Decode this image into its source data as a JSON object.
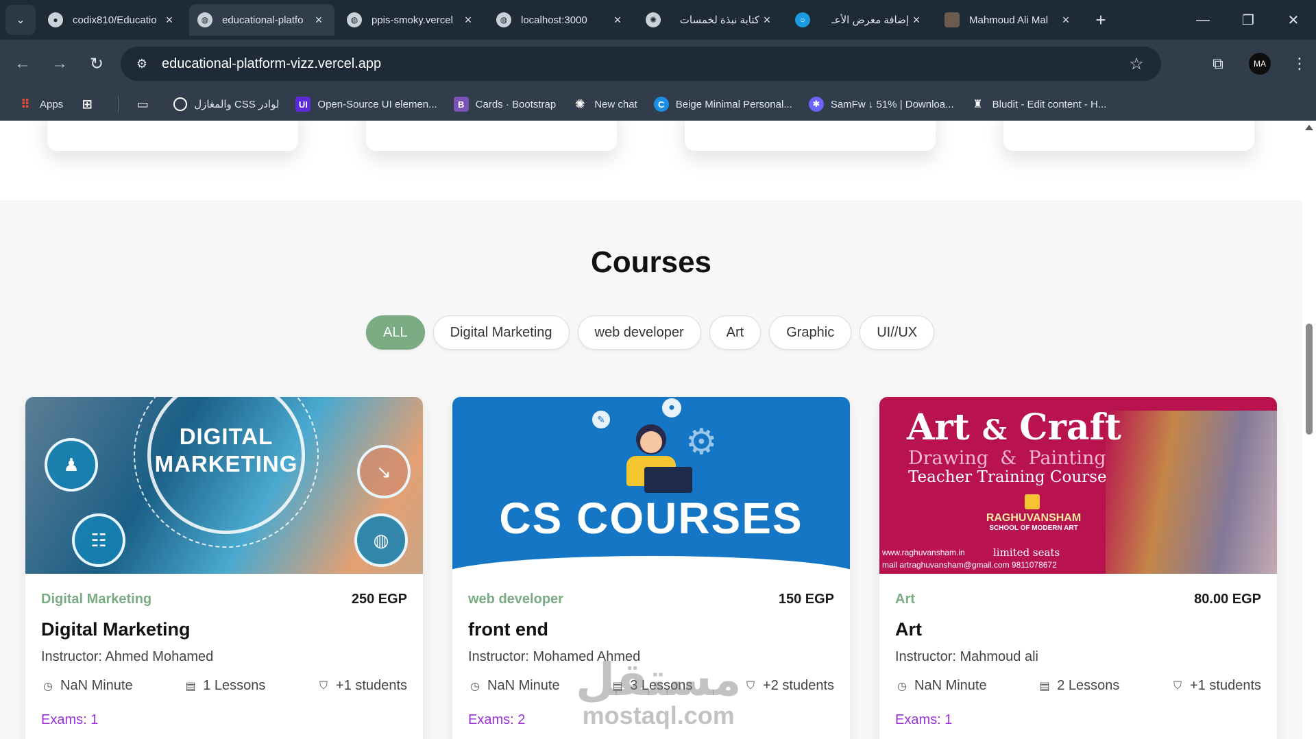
{
  "browser": {
    "tabs": [
      {
        "title": "codix810/Educatio",
        "favicon": "github-icon",
        "active": false
      },
      {
        "title": "educational-platfo",
        "favicon": "globe-icon",
        "active": true
      },
      {
        "title": "ppis-smoky.vercel",
        "favicon": "globe-icon",
        "active": false
      },
      {
        "title": "localhost:3000",
        "favicon": "globe-icon",
        "active": false
      },
      {
        "title": "كتابة نبذة لخمسات",
        "favicon": "chatgpt-icon",
        "active": false
      },
      {
        "title": "إضافة معرض الأعـ",
        "favicon": "mostaql-icon",
        "active": false
      },
      {
        "title": "Mahmoud Ali Mal",
        "favicon": "avatar-icon",
        "active": false
      }
    ],
    "url": "educational-platform-vizz.vercel.app",
    "avatar_initials": "MA",
    "bookmarks": [
      {
        "label": "Apps",
        "icon": "apps-grid-icon",
        "color": "#e8453c"
      },
      {
        "label": "",
        "icon": "tab-groups-icon",
        "color": "#dfe6ee"
      },
      {
        "label": "",
        "icon": "folder-icon",
        "color": "#dfe6ee"
      },
      {
        "label": "لوادر CSS والمغازل",
        "icon": "loader-icon",
        "color": "#ffffff"
      },
      {
        "label": "Open-Source UI elemen...",
        "icon": "uiverse-icon",
        "color": "#5b2bd9"
      },
      {
        "label": "Cards · Bootstrap",
        "icon": "bootstrap-icon",
        "color": "#7952b3"
      },
      {
        "label": "New chat",
        "icon": "chatgpt-icon",
        "color": "#dfe6ee"
      },
      {
        "label": "Beige Minimal Personal...",
        "icon": "canva-icon",
        "color": "#1b8fe6"
      },
      {
        "label": "SamFw ↓ 51% | Downloa...",
        "icon": "samfw-icon",
        "color": "#6c63ff"
      },
      {
        "label": "Bludit - Edit content - H...",
        "icon": "bludit-icon",
        "color": "#ffffff"
      }
    ]
  },
  "page": {
    "section_title": "Courses",
    "filters": [
      {
        "label": "ALL",
        "active": true
      },
      {
        "label": "Digital Marketing",
        "active": false
      },
      {
        "label": "web developer",
        "active": false
      },
      {
        "label": "Art",
        "active": false
      },
      {
        "label": "Graphic",
        "active": false
      },
      {
        "label": "UI//UX",
        "active": false
      }
    ],
    "courses": [
      {
        "category": "Digital Marketing",
        "price": "250 EGP",
        "title": "Digital Marketing",
        "instructor": "Instructor: Ahmed Mohamed",
        "duration": "NaN Minute",
        "lessons": "1 Lessons",
        "students": "+1 students",
        "exams": "Exams: 1",
        "thumb_text": [
          "DIGITAL",
          "MARKETING"
        ]
      },
      {
        "category": "web developer",
        "price": "150 EGP",
        "title": "front end",
        "instructor": "Instructor: Mohamed Ahmed",
        "duration": "NaN Minute",
        "lessons": "3 Lessons",
        "students": "+2 students",
        "exams": "Exams: 2",
        "thumb_text": [
          "CS COURSES"
        ]
      },
      {
        "category": "Art",
        "price": "80.00 EGP",
        "title": "Art",
        "instructor": "Instructor: Mahmoud ali",
        "duration": "NaN Minute",
        "lessons": "2 Lessons",
        "students": "+1 students",
        "exams": "Exams: 1",
        "thumb_text": [
          "Art",
          "Craft",
          "Drawing",
          "Painting",
          "Teacher Training Course",
          "RAGHUVANSHAM",
          "SCHOOL OF MODERN ART",
          "limited seats",
          "www.raghuvansham.in",
          "mail artraghuvansham@gmail.com 9811078672"
        ]
      }
    ],
    "watermark": [
      "مستقل",
      "mostaql.com"
    ]
  },
  "colors": {
    "accent": "#7aab83",
    "exams": "#9b30d9",
    "tabbar": "#1f2a37",
    "toolbar": "#313d4b"
  }
}
